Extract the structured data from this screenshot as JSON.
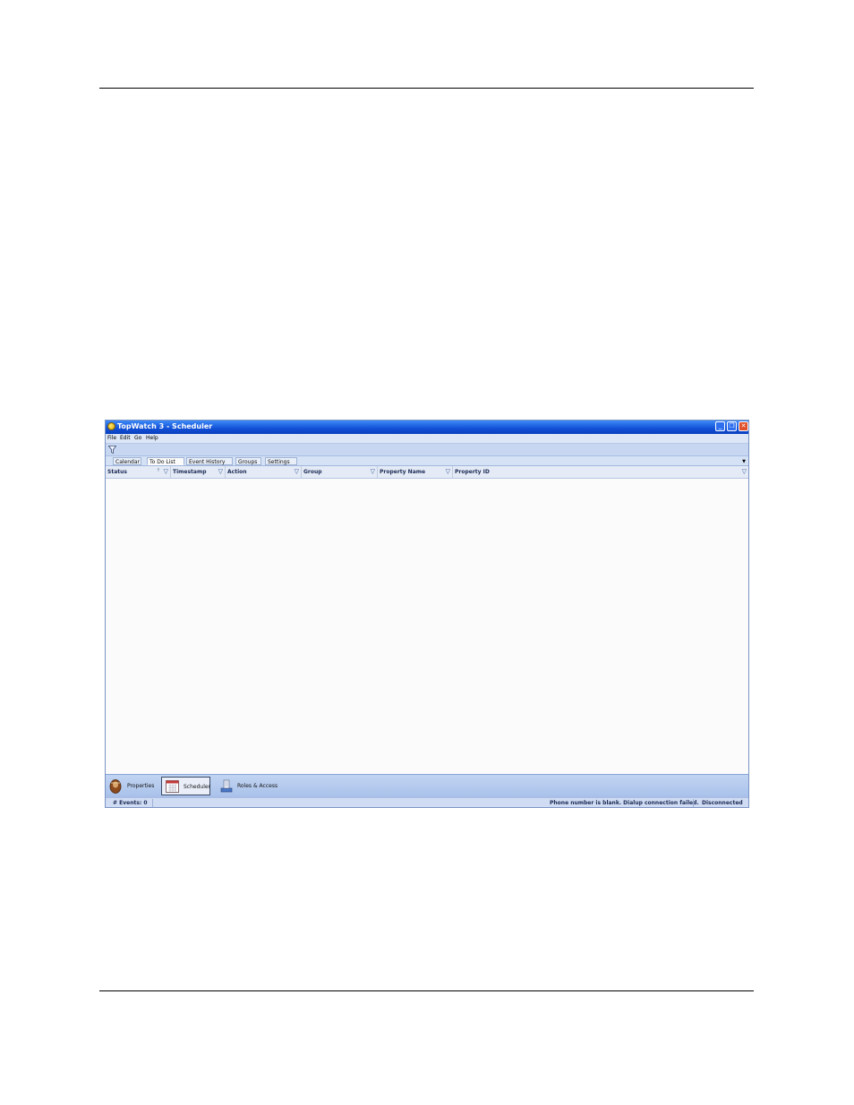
{
  "window": {
    "title": "TopWatch 3 - Scheduler",
    "controls": {
      "minimize": "_",
      "maximize": "❐",
      "close": "✕"
    }
  },
  "menu": [
    "File",
    "Edit",
    "Go",
    "Help"
  ],
  "toolbar": {
    "icon": "filter-icon"
  },
  "tabs": [
    {
      "label": "Calendar"
    },
    {
      "label": "To Do List"
    },
    {
      "label": "Event History"
    },
    {
      "label": "Groups"
    },
    {
      "label": "Settings"
    }
  ],
  "active_tab": "To Do List",
  "columns": [
    {
      "label": "Status"
    },
    {
      "label": "Timestamp"
    },
    {
      "label": "Action"
    },
    {
      "label": "Group"
    },
    {
      "label": "Property Name"
    },
    {
      "label": "Property ID"
    }
  ],
  "rows": [],
  "nav": [
    {
      "label": "Properties",
      "icon": "properties-icon"
    },
    {
      "label": "Scheduler",
      "icon": "calendar-icon"
    },
    {
      "label": "Roles & Access",
      "icon": "roles-icon"
    }
  ],
  "active_nav": "Scheduler",
  "status": {
    "events": "# Events: 0",
    "message": "Phone number is blank. Dialup connection failed.",
    "connection": "Disconnected"
  },
  "colors": {
    "titlebar": "#1250d6",
    "close_button": "#e0502a"
  }
}
